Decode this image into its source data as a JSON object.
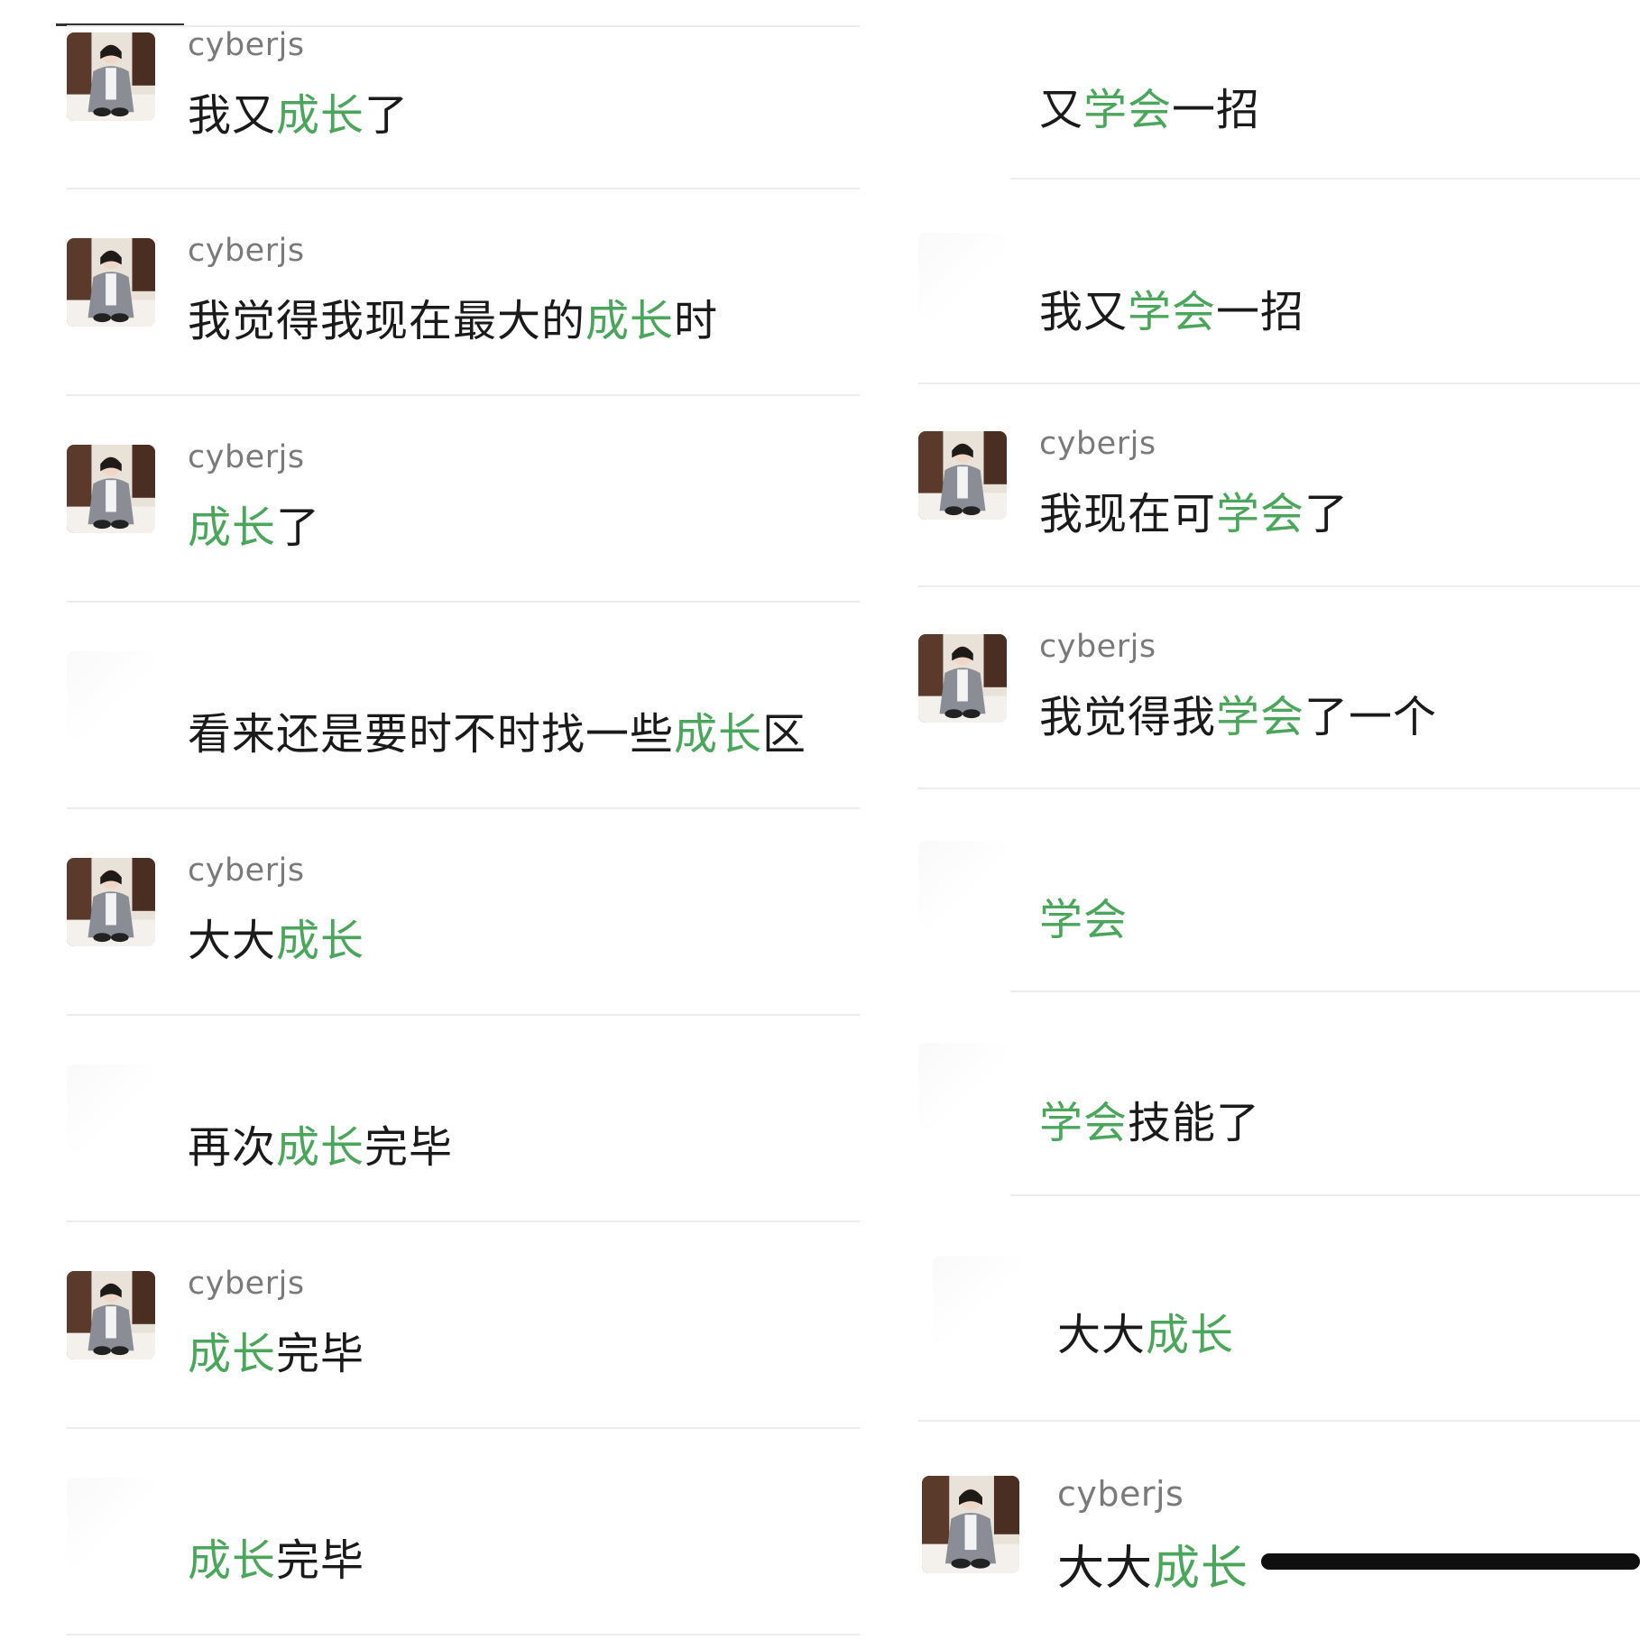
{
  "left_column": {
    "rows": [
      {
        "username": "cyberjs",
        "parts": [
          {
            "t": "我又",
            "h": false
          },
          {
            "t": "成长",
            "h": true
          },
          {
            "t": "了",
            "h": false
          }
        ]
      },
      {
        "username": "cyberjs",
        "parts": [
          {
            "t": "我觉得我现在最大的",
            "h": false
          },
          {
            "t": "成长",
            "h": true
          },
          {
            "t": "时",
            "h": false
          }
        ]
      },
      {
        "username": "cyberjs",
        "parts": [
          {
            "t": "成长",
            "h": true
          },
          {
            "t": "了",
            "h": false
          }
        ]
      },
      {
        "username": "",
        "parts": [
          {
            "t": "看来还是要时不时找一些",
            "h": false
          },
          {
            "t": "成长",
            "h": true
          },
          {
            "t": "区",
            "h": false
          }
        ]
      },
      {
        "username": "cyberjs",
        "parts": [
          {
            "t": "大大",
            "h": false
          },
          {
            "t": "成长",
            "h": true
          }
        ]
      },
      {
        "username": "",
        "parts": [
          {
            "t": "再次",
            "h": false
          },
          {
            "t": "成长",
            "h": true
          },
          {
            "t": "完毕",
            "h": false
          }
        ]
      },
      {
        "username": "cyberjs",
        "parts": [
          {
            "t": "成长",
            "h": true
          },
          {
            "t": "完毕",
            "h": false
          }
        ]
      },
      {
        "username": "",
        "parts": [
          {
            "t": "成长",
            "h": true
          },
          {
            "t": "完毕",
            "h": false
          }
        ]
      }
    ]
  },
  "right_column": {
    "rows": [
      {
        "username": "",
        "parts": [
          {
            "t": "又",
            "h": false
          },
          {
            "t": "学会",
            "h": true
          },
          {
            "t": "一招",
            "h": false
          }
        ]
      },
      {
        "username": "",
        "parts": [
          {
            "t": "我又",
            "h": false
          },
          {
            "t": "学会",
            "h": true
          },
          {
            "t": "一招",
            "h": false
          }
        ]
      },
      {
        "username": "cyberjs",
        "parts": [
          {
            "t": "我现在可",
            "h": false
          },
          {
            "t": "学会",
            "h": true
          },
          {
            "t": "了",
            "h": false
          }
        ]
      },
      {
        "username": "cyberjs",
        "parts": [
          {
            "t": "我觉得我",
            "h": false
          },
          {
            "t": "学会",
            "h": true
          },
          {
            "t": "了一个",
            "h": false
          }
        ]
      },
      {
        "username": "",
        "parts": [
          {
            "t": "学会",
            "h": true
          }
        ]
      },
      {
        "username": "",
        "parts": [
          {
            "t": "学会",
            "h": true
          },
          {
            "t": "技能了",
            "h": false
          }
        ]
      },
      {
        "username": "",
        "parts": [
          {
            "t": "大大",
            "h": false
          },
          {
            "t": "成长",
            "h": true
          }
        ]
      },
      {
        "username": "cyberjs",
        "parts": [
          {
            "t": "大大",
            "h": false
          },
          {
            "t": "成长",
            "h": true
          }
        ]
      }
    ]
  },
  "colors": {
    "highlight": "#4aa65a",
    "text": "#1a1a1a",
    "username": "#7a7a7a",
    "divider": "#ececec",
    "background": "#ffffff"
  },
  "icons": {
    "avatar": "avatar-photo-icon",
    "home_indicator": "home-indicator-bar"
  }
}
